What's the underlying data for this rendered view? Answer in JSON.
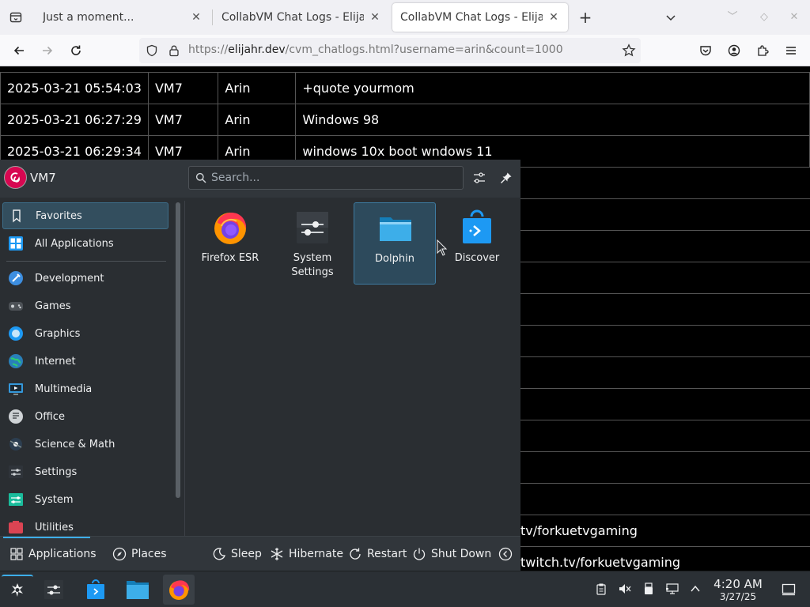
{
  "browser": {
    "tabs": [
      {
        "title": "Just a moment...",
        "active": false
      },
      {
        "title": "CollabVM Chat Logs - Elijahr's",
        "active": false
      },
      {
        "title": "CollabVM Chat Logs - Elijahr's",
        "active": true
      }
    ],
    "url": {
      "scheme": "https://",
      "domain": "elijahr.dev",
      "path": "/cvm_chatlogs.html?username=arin&count=1000"
    }
  },
  "chatlog": {
    "rows": [
      {
        "time": "2025-03-21 05:54:03",
        "vm": "VM7",
        "user": "Arin",
        "message": "+quote yourmom"
      },
      {
        "time": "2025-03-21 06:27:29",
        "vm": "VM7",
        "user": "Arin",
        "message": "Windows 98"
      },
      {
        "time": "2025-03-21 06:29:34",
        "vm": "VM7",
        "user": "Arin",
        "message": "windows 10x boot wndows 11"
      }
    ],
    "partial_messages": [
      "tv/forkuetvgaming",
      "twitch.tv/forkuetvgaming"
    ]
  },
  "launcher": {
    "username": "VM7",
    "search_placeholder": "Search...",
    "categories": [
      {
        "label": "Favorites",
        "icon": "bookmark-icon",
        "selected": true
      },
      {
        "label": "All Applications",
        "icon": "grid-icon",
        "selected": false
      },
      {
        "label": "Development",
        "icon": "development-icon",
        "selected": false
      },
      {
        "label": "Games",
        "icon": "gamepad-icon",
        "selected": false
      },
      {
        "label": "Graphics",
        "icon": "graphics-icon",
        "selected": false
      },
      {
        "label": "Internet",
        "icon": "globe-icon",
        "selected": false
      },
      {
        "label": "Multimedia",
        "icon": "multimedia-icon",
        "selected": false
      },
      {
        "label": "Office",
        "icon": "office-icon",
        "selected": false
      },
      {
        "label": "Science & Math",
        "icon": "science-icon",
        "selected": false
      },
      {
        "label": "Settings",
        "icon": "settings-icon",
        "selected": false
      },
      {
        "label": "System",
        "icon": "system-icon",
        "selected": false
      },
      {
        "label": "Utilities",
        "icon": "utilities-icon",
        "selected": false
      }
    ],
    "favorites": [
      {
        "label": "Firefox ESR",
        "icon": "firefox-icon"
      },
      {
        "label": "System Settings",
        "icon": "system-settings-icon"
      },
      {
        "label": "Dolphin",
        "icon": "folder-icon",
        "hovered": true
      },
      {
        "label": "Discover",
        "icon": "discover-icon"
      }
    ],
    "footer": {
      "applications": "Applications",
      "places": "Places",
      "sleep": "Sleep",
      "hibernate": "Hibernate",
      "restart": "Restart",
      "shutdown": "Shut Down"
    }
  },
  "taskbar": {
    "clock_time": "4:20 AM",
    "clock_date": "3/27/25"
  },
  "colors": {
    "accent": "#3daee9",
    "launcher_bg": "#2a2e32",
    "panel_bg": "#2b3035",
    "selection": "#334e5e"
  }
}
